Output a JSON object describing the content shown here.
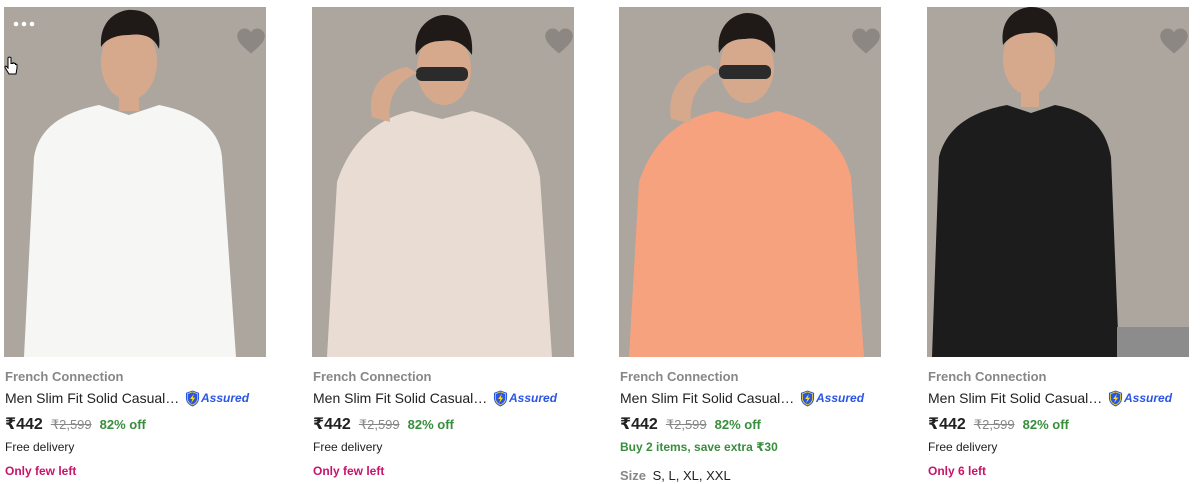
{
  "products": [
    {
      "brand": "French Connection",
      "title": "Men Slim Fit Solid Casual Shirt",
      "assured_label": "Assured",
      "price": "₹442",
      "mrp": "₹2,599",
      "discount": "82% off",
      "delivery": "Free delivery",
      "stock": "Only few left",
      "shirt_color": "#f6f6f4",
      "wishlist_icon": "heart-icon"
    },
    {
      "brand": "French Connection",
      "title": "Men Slim Fit Solid Casual Shirt",
      "assured_label": "Assured",
      "price": "₹442",
      "mrp": "₹2,599",
      "discount": "82% off",
      "delivery": "Free delivery",
      "stock": "Only few left",
      "shirt_color": "#e9ddd3",
      "wishlist_icon": "heart-icon"
    },
    {
      "brand": "French Connection",
      "title": "Men Slim Fit Solid Casual Shirt",
      "assured_label": "Assured",
      "price": "₹442",
      "mrp": "₹2,599",
      "discount": "82% off",
      "offer": "Buy 2 items, save extra ₹30",
      "size_label": "Size",
      "sizes": "S, L, XL, XXL",
      "shirt_color": "#f7a27f",
      "wishlist_icon": "heart-icon"
    },
    {
      "brand": "French Connection",
      "title": "Men Slim Fit Solid Casual Shirt",
      "assured_label": "Assured",
      "price": "₹442",
      "mrp": "₹2,599",
      "discount": "82% off",
      "delivery": "Free delivery",
      "stock": "Only 6 left",
      "shirt_color": "#1c1c1c",
      "wishlist_icon": "heart-icon"
    }
  ],
  "colors": {
    "brand_gray": "#878787",
    "discount_green": "#388e3c",
    "stock_pink": "#c7146a",
    "assured_blue": "#2a55e5",
    "photo_background": "#aca69f"
  }
}
